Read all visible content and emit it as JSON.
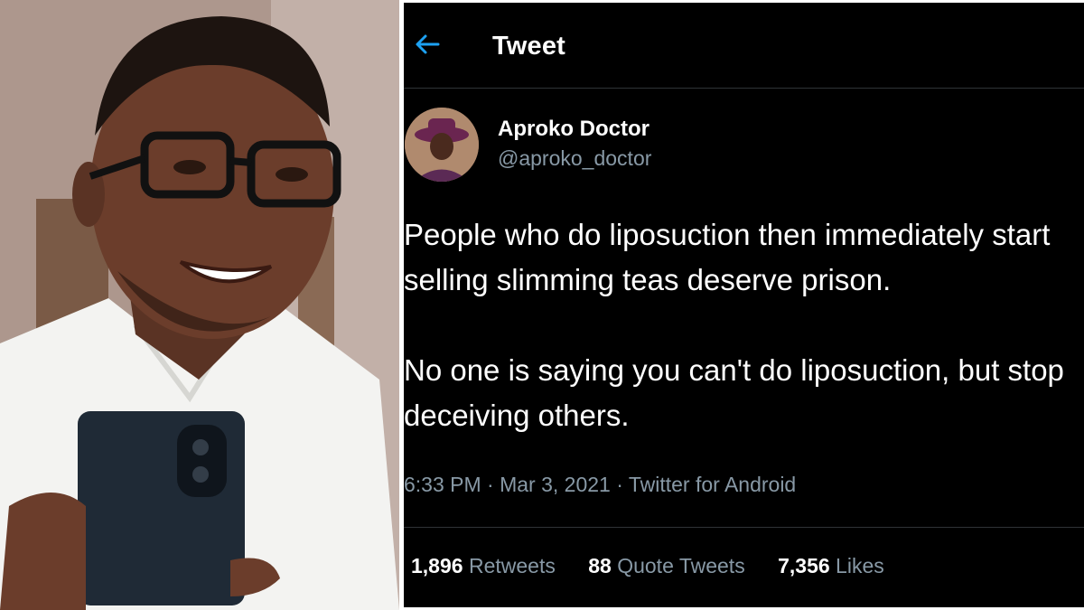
{
  "colors": {
    "background": "#000000",
    "primary_text": "#ffffff",
    "secondary_text": "#8899a6",
    "accent": "#1da1f2",
    "divider": "#2f3336"
  },
  "icons": {
    "back": "back-arrow-icon"
  },
  "header": {
    "title": "Tweet"
  },
  "author": {
    "display_name": "Aproko Doctor",
    "handle": "@aproko_doctor"
  },
  "tweet": {
    "text": "People who do liposuction then immediately start\nselling slimming teas deserve prison.\n\nNo one is saying you can't do liposuction, but stop\ndeceiving others.",
    "timestamp": "6:33 PM · Mar 3, 2021 · Twitter for Android"
  },
  "stats": {
    "retweets_count": "1,896",
    "retweets_label": "Retweets",
    "quotes_count": "88",
    "quotes_label": "Quote Tweets",
    "likes_count": "7,356",
    "likes_label": "Likes"
  }
}
